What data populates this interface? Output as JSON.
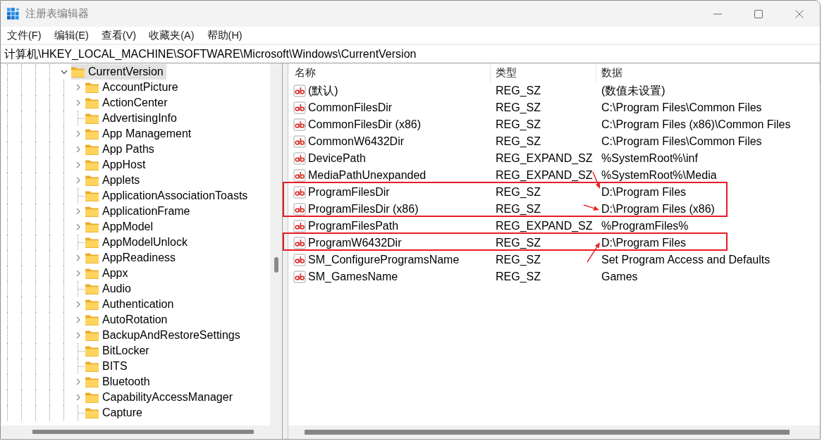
{
  "window": {
    "title": "注册表编辑器"
  },
  "menu": [
    "文件(F)",
    "编辑(E)",
    "查看(V)",
    "收藏夹(A)",
    "帮助(H)"
  ],
  "address": "计算机\\HKEY_LOCAL_MACHINE\\SOFTWARE\\Microsoft\\Windows\\CurrentVersion",
  "tree": [
    {
      "label": "CurrentVersion",
      "expandable": true,
      "expanded": true,
      "selected": true,
      "children": [
        {
          "label": "AccountPicture",
          "expandable": true,
          "expanded": false,
          "selected": false
        },
        {
          "label": "ActionCenter",
          "expandable": true,
          "expanded": false,
          "selected": false
        },
        {
          "label": "AdvertisingInfo",
          "expandable": false,
          "selected": false
        },
        {
          "label": "App Management",
          "expandable": true,
          "expanded": false,
          "selected": false
        },
        {
          "label": "App Paths",
          "expandable": true,
          "expanded": false,
          "selected": false
        },
        {
          "label": "AppHost",
          "expandable": true,
          "expanded": false,
          "selected": false
        },
        {
          "label": "Applets",
          "expandable": true,
          "expanded": false,
          "selected": false
        },
        {
          "label": "ApplicationAssociationToasts",
          "expandable": false,
          "selected": false
        },
        {
          "label": "ApplicationFrame",
          "expandable": true,
          "expanded": false,
          "selected": false
        },
        {
          "label": "AppModel",
          "expandable": true,
          "expanded": false,
          "selected": false
        },
        {
          "label": "AppModelUnlock",
          "expandable": false,
          "selected": false
        },
        {
          "label": "AppReadiness",
          "expandable": true,
          "expanded": false,
          "selected": false
        },
        {
          "label": "Appx",
          "expandable": true,
          "expanded": false,
          "selected": false
        },
        {
          "label": "Audio",
          "expandable": false,
          "selected": false
        },
        {
          "label": "Authentication",
          "expandable": true,
          "expanded": false,
          "selected": false
        },
        {
          "label": "AutoRotation",
          "expandable": true,
          "expanded": false,
          "selected": false
        },
        {
          "label": "BackupAndRestoreSettings",
          "expandable": true,
          "expanded": false,
          "selected": false
        },
        {
          "label": "BitLocker",
          "expandable": false,
          "selected": false
        },
        {
          "label": "BITS",
          "expandable": false,
          "selected": false
        },
        {
          "label": "Bluetooth",
          "expandable": true,
          "expanded": false,
          "selected": false
        },
        {
          "label": "CapabilityAccessManager",
          "expandable": true,
          "expanded": false,
          "selected": false
        },
        {
          "label": "Capture",
          "expandable": false,
          "selected": false
        }
      ]
    }
  ],
  "values": {
    "columns": [
      "名称",
      "类型",
      "数据"
    ],
    "rows": [
      {
        "name": "(默认)",
        "reg_type": "REG_SZ",
        "data": "(数值未设置)",
        "marked": false
      },
      {
        "name": "CommonFilesDir",
        "reg_type": "REG_SZ",
        "data": "C:\\Program Files\\Common Files",
        "marked": false
      },
      {
        "name": "CommonFilesDir (x86)",
        "reg_type": "REG_SZ",
        "data": "C:\\Program Files (x86)\\Common Files",
        "marked": false
      },
      {
        "name": "CommonW6432Dir",
        "reg_type": "REG_SZ",
        "data": "C:\\Program Files\\Common Files",
        "marked": false
      },
      {
        "name": "DevicePath",
        "reg_type": "REG_EXPAND_SZ",
        "data": "%SystemRoot%\\inf",
        "marked": false
      },
      {
        "name": "MediaPathUnexpanded",
        "reg_type": "REG_EXPAND_SZ",
        "data": "%SystemRoot%\\Media",
        "marked": false
      },
      {
        "name": "ProgramFilesDir",
        "reg_type": "REG_SZ",
        "data": "D:\\Program Files",
        "marked": true,
        "arrow": {
          "kind": "down"
        }
      },
      {
        "name": "ProgramFilesDir (x86)",
        "reg_type": "REG_SZ",
        "data": "D:\\Program Files (x86)",
        "marked": true,
        "arrow": {
          "kind": "right"
        }
      },
      {
        "name": "ProgramFilesPath",
        "reg_type": "REG_EXPAND_SZ",
        "data": "%ProgramFiles%",
        "marked": false
      },
      {
        "name": "ProgramW6432Dir",
        "reg_type": "REG_SZ",
        "data": "D:\\Program Files",
        "marked": true,
        "arrow": {
          "kind": "up"
        }
      },
      {
        "name": "SM_ConfigureProgramsName",
        "reg_type": "REG_SZ",
        "data": "Set Program Access and Defaults",
        "marked": false
      },
      {
        "name": "SM_GamesName",
        "reg_type": "REG_SZ",
        "data": "Games",
        "marked": false
      }
    ]
  }
}
